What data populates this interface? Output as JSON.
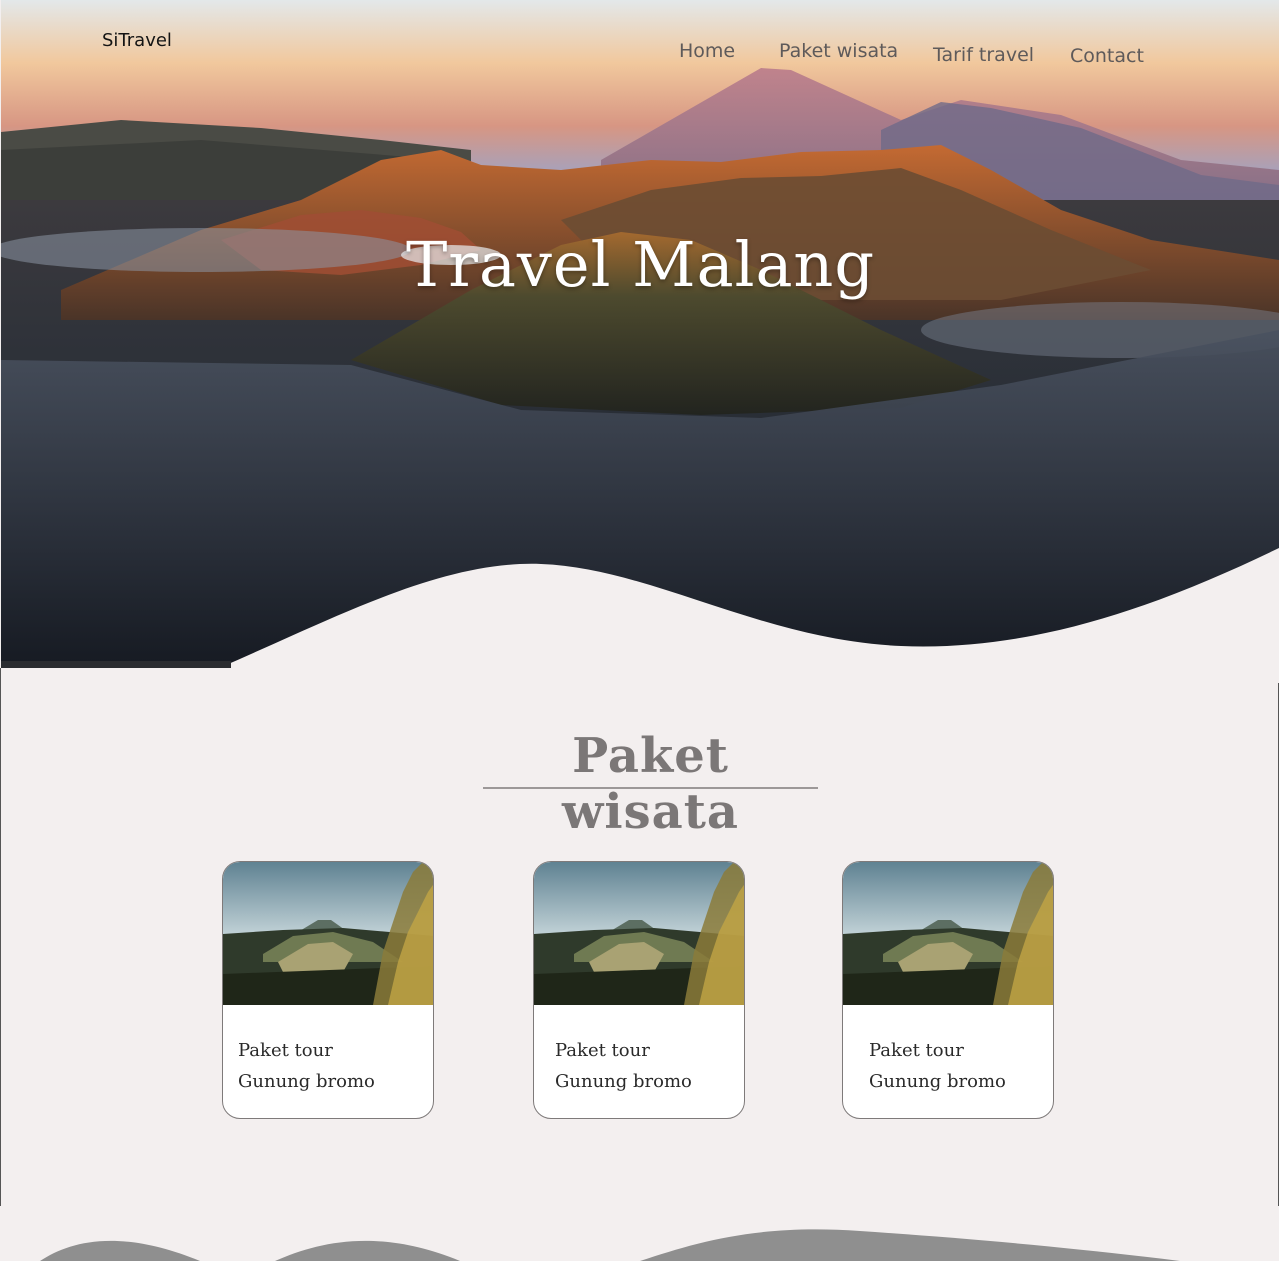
{
  "brand": "SiTravel",
  "nav": {
    "items": [
      {
        "label": "Home"
      },
      {
        "label": "Paket wisata"
      },
      {
        "label": "Tarif travel"
      },
      {
        "label": "Contact"
      }
    ]
  },
  "hero": {
    "title": "Travel Malang"
  },
  "section": {
    "title": "Paket wisata"
  },
  "cards": [
    {
      "line1": "Paket tour",
      "line2": "Gunung bromo"
    },
    {
      "line1": "Paket tour",
      "line2": "Gunung bromo"
    },
    {
      "line1": "Paket tour",
      "line2": "Gunung bromo"
    }
  ],
  "colors": {
    "background": "#f3efef",
    "nav_text": "#5e5a5a",
    "section_title": "#7b7777",
    "footer_wave": "#8f8f8f"
  }
}
